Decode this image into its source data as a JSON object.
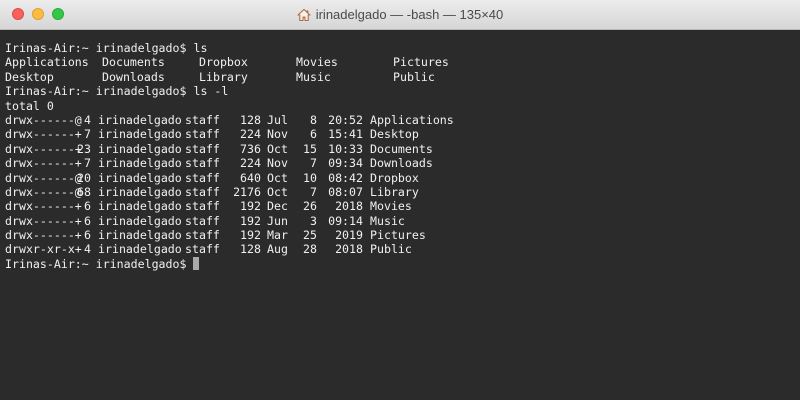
{
  "window": {
    "title": "irinadelgado — -bash — 135×40",
    "icon": "home-icon"
  },
  "terminal": {
    "prompt1": "Irinas-Air:~ irinadelgado$ ls",
    "ls_items": [
      "Applications",
      "Documents",
      "Dropbox",
      "Movies",
      "Pictures",
      "Desktop",
      "Downloads",
      "Library",
      "Music",
      "Public"
    ],
    "prompt2": "Irinas-Air:~ irinadelgado$ ls -l",
    "total": "total 0",
    "entries": [
      {
        "perm": "drwx------@",
        "links": "4",
        "owner": "irinadelgado",
        "group": "staff",
        "size": "128",
        "month": "Jul",
        "day": "8",
        "time": "20:52",
        "name": "Applications"
      },
      {
        "perm": "drwx------+",
        "links": "7",
        "owner": "irinadelgado",
        "group": "staff",
        "size": "224",
        "month": "Nov",
        "day": "6",
        "time": "15:41",
        "name": "Desktop"
      },
      {
        "perm": "drwx------+",
        "links": "23",
        "owner": "irinadelgado",
        "group": "staff",
        "size": "736",
        "month": "Oct",
        "day": "15",
        "time": "10:33",
        "name": "Documents"
      },
      {
        "perm": "drwx------+",
        "links": "7",
        "owner": "irinadelgado",
        "group": "staff",
        "size": "224",
        "month": "Nov",
        "day": "7",
        "time": "09:34",
        "name": "Downloads"
      },
      {
        "perm": "drwx------@",
        "links": "20",
        "owner": "irinadelgado",
        "group": "staff",
        "size": "640",
        "month": "Oct",
        "day": "10",
        "time": "08:42",
        "name": "Dropbox"
      },
      {
        "perm": "drwx------@",
        "links": "68",
        "owner": "irinadelgado",
        "group": "staff",
        "size": "2176",
        "month": "Oct",
        "day": "7",
        "time": "08:07",
        "name": "Library"
      },
      {
        "perm": "drwx------+",
        "links": "6",
        "owner": "irinadelgado",
        "group": "staff",
        "size": "192",
        "month": "Dec",
        "day": "26",
        "time": "2018",
        "name": "Movies"
      },
      {
        "perm": "drwx------+",
        "links": "6",
        "owner": "irinadelgado",
        "group": "staff",
        "size": "192",
        "month": "Jun",
        "day": "3",
        "time": "09:14",
        "name": "Music"
      },
      {
        "perm": "drwx------+",
        "links": "6",
        "owner": "irinadelgado",
        "group": "staff",
        "size": "192",
        "month": "Mar",
        "day": "25",
        "time": "2019",
        "name": "Pictures"
      },
      {
        "perm": "drwxr-xr-x+",
        "links": "4",
        "owner": "irinadelgado",
        "group": "staff",
        "size": "128",
        "month": "Aug",
        "day": "28",
        "time": "2018",
        "name": "Public"
      }
    ],
    "prompt3": "Irinas-Air:~ irinadelgado$"
  },
  "colors": {
    "background": "#2b2b2b",
    "text": "#f0f0f0",
    "cursor": "#a9a9a9",
    "close": "#fc605c",
    "minimize": "#fdbc40",
    "maximize": "#34c84a"
  }
}
